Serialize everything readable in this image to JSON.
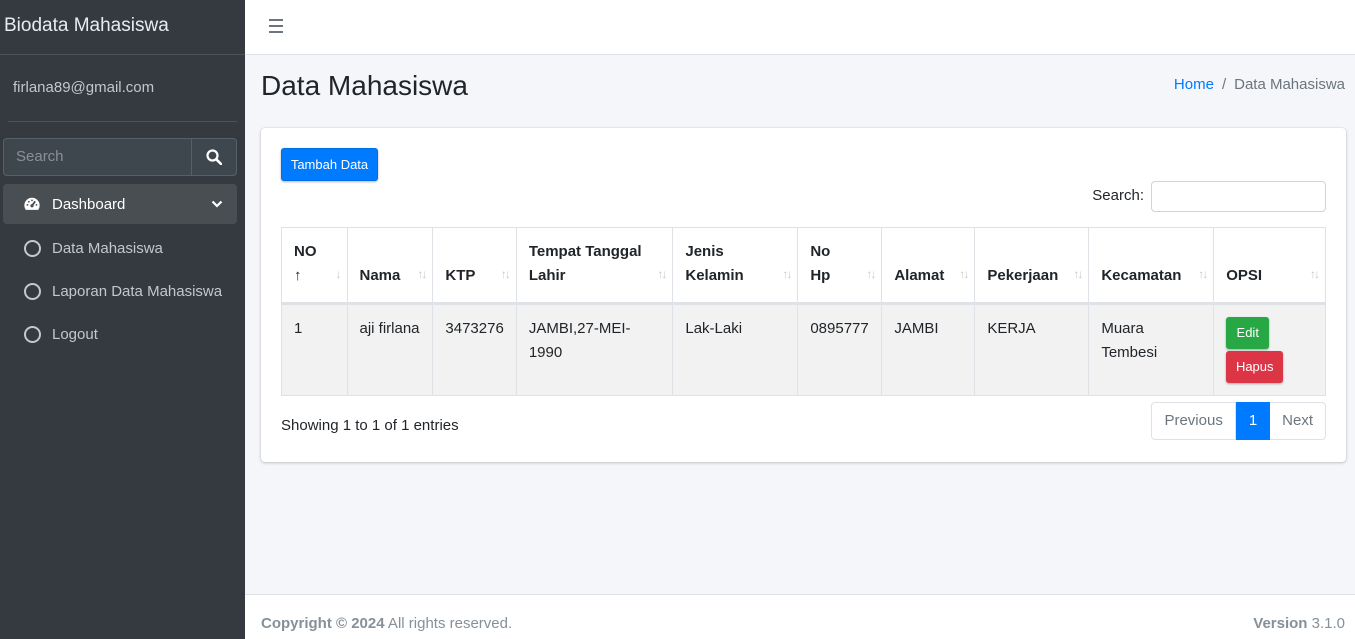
{
  "sidebar": {
    "brand": "Biodata Mahasiswa",
    "user": "firlana89@gmail.com",
    "search_placeholder": "Search",
    "items": [
      {
        "label": "Dashboard"
      },
      {
        "label": "Data Mahasiswa"
      },
      {
        "label": "Laporan Data Mahasiswa"
      },
      {
        "label": "Logout"
      }
    ]
  },
  "header": {
    "title": "Data Mahasiswa",
    "breadcrumb_home": "Home",
    "breadcrumb_sep": "/",
    "breadcrumb_current": "Data Mahasiswa"
  },
  "card": {
    "add_button": "Tambah Data",
    "search_label": "Search:",
    "columns": [
      "NO",
      "Nama",
      "KTP",
      "Tempat Tanggal Lahir",
      "Jenis Kelamin",
      "No Hp",
      "Alamat",
      "Pekerjaan",
      "Kecamatan",
      "OPSI"
    ],
    "rows": [
      {
        "no": "1",
        "nama": "aji firlana",
        "ktp": "3473276",
        "ttl": "JAMBI,27-MEI-1990",
        "jk": "Lak-Laki",
        "hp": "0895777",
        "alamat": "JAMBI",
        "pekerjaan": "KERJA",
        "kecamatan": "Muara Tembesi",
        "edit": "Edit",
        "hapus": "Hapus"
      }
    ],
    "info": "Showing 1 to 1 of 1 entries",
    "pager": {
      "previous": "Previous",
      "current": "1",
      "next": "Next"
    }
  },
  "footer": {
    "copyright": "Copyright © 2024",
    "rights": " All rights reserved.",
    "version_label": "Version",
    "version": " 3.1.0"
  }
}
